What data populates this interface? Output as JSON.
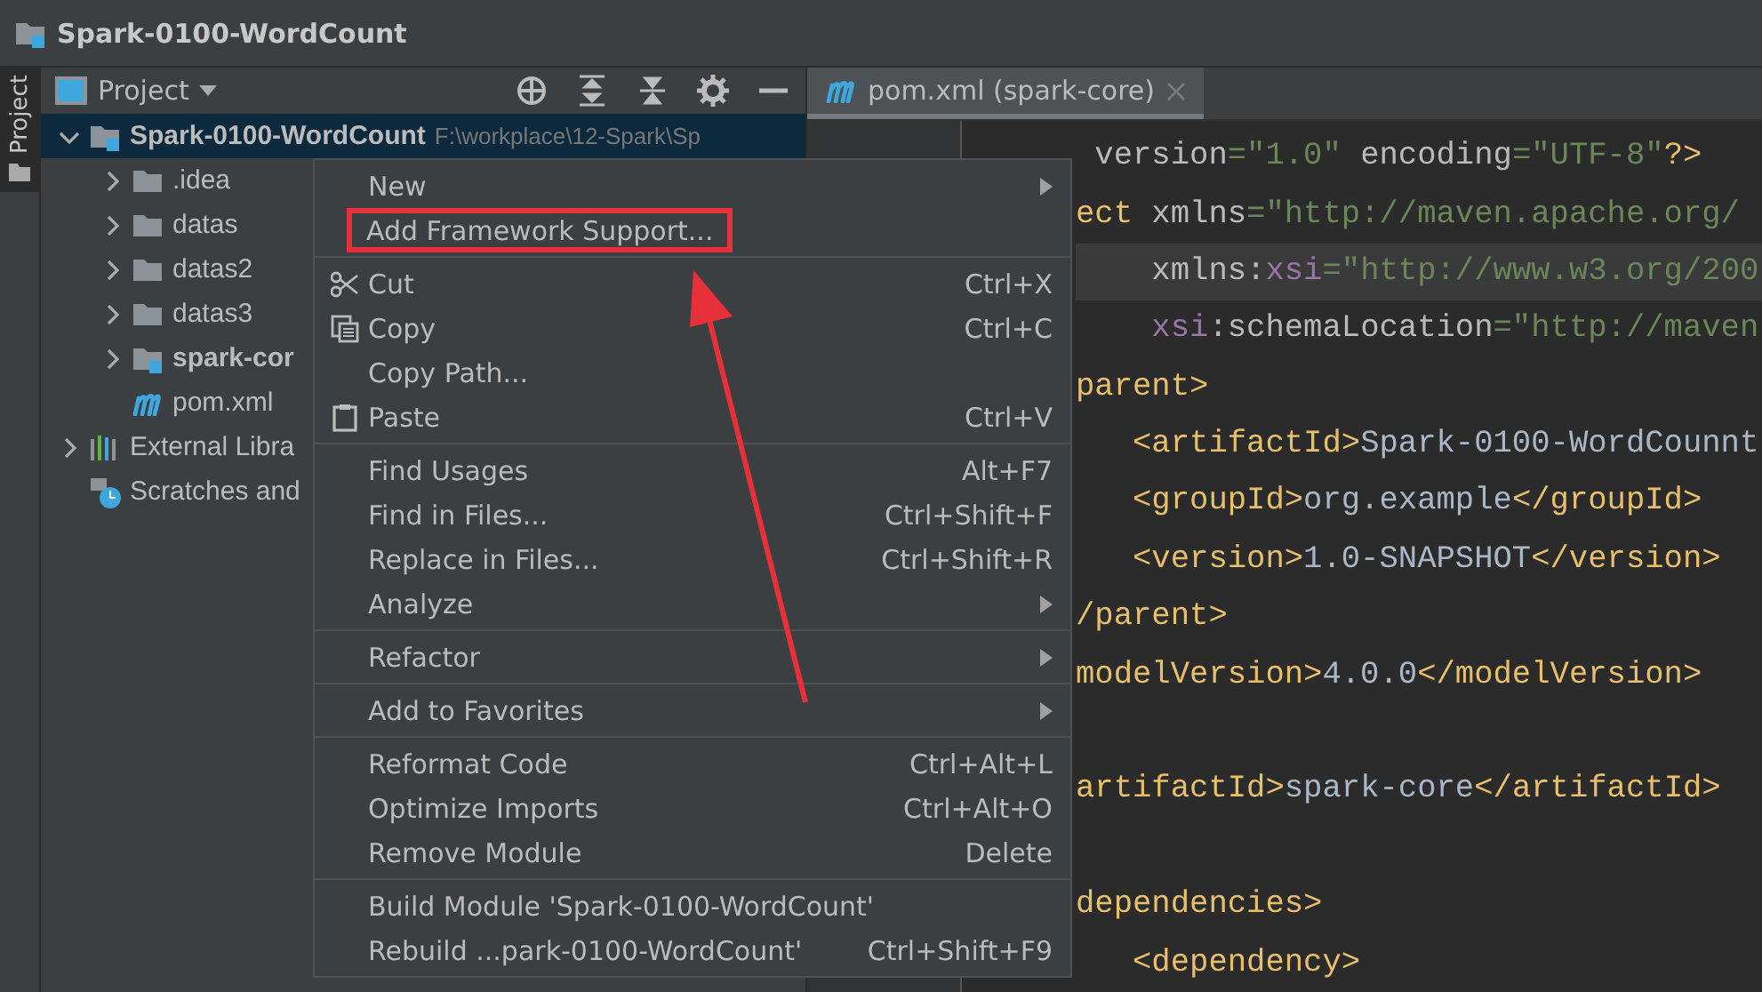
{
  "window": {
    "title": "Spark-0100-WordCount"
  },
  "side_strip": {
    "tab": "Project"
  },
  "project_panel": {
    "view": "Project",
    "tree": [
      {
        "label": "Spark-0100-WordCount",
        "path": "F:\\workplace\\12-Spark\\Sp",
        "kind": "module",
        "expanded": true,
        "selected": true,
        "children": [
          {
            "label": ".idea",
            "kind": "folder",
            "expanded": false,
            "selected": false
          },
          {
            "label": "datas",
            "kind": "folder",
            "expanded": false,
            "selected": false
          },
          {
            "label": "datas2",
            "kind": "folder",
            "expanded": false,
            "selected": false
          },
          {
            "label": "datas3",
            "kind": "folder",
            "expanded": false,
            "selected": false
          },
          {
            "label": "spark-cor",
            "kind": "module",
            "expanded": false,
            "selected": false
          },
          {
            "label": "pom.xml",
            "kind": "maven",
            "selected": false
          }
        ]
      },
      {
        "label": "External Libra",
        "kind": "library",
        "expanded": false,
        "selected": false
      },
      {
        "label": "Scratches and",
        "kind": "scratches",
        "selected": false
      }
    ]
  },
  "editor": {
    "tabs": [
      {
        "label": "pom.xml (spark-core)",
        "selected": true
      }
    ],
    "lines": [
      {
        "kind": "code",
        "current": false,
        "segments": [
          {
            "kind": "attr",
            "text": " version"
          },
          {
            "kind": "value",
            "text": "=\"1.0\""
          },
          {
            "kind": "attr",
            "text": " encoding"
          },
          {
            "kind": "value",
            "text": "=\"UTF-8\""
          },
          {
            "kind": "tag",
            "text": "?>"
          }
        ]
      },
      {
        "kind": "code",
        "current": false,
        "segments": [
          {
            "kind": "tag",
            "text": "ect"
          },
          {
            "kind": "attr",
            "text": " xmlns"
          },
          {
            "kind": "value",
            "text": "=\"http://maven.apache.org/"
          }
        ]
      },
      {
        "kind": "code",
        "current": true,
        "segments": [
          {
            "kind": "attr",
            "text": "    xmlns:"
          },
          {
            "kind": "ns",
            "text": "xsi"
          },
          {
            "kind": "value",
            "text": "=\"http://www.w3.org/200"
          }
        ]
      },
      {
        "kind": "code",
        "current": false,
        "segments": [
          {
            "kind": "ns",
            "text": "    xsi"
          },
          {
            "kind": "attr",
            "text": ":schemaLocation"
          },
          {
            "kind": "value",
            "text": "=\"http://maven"
          }
        ]
      },
      {
        "kind": "code",
        "current": false,
        "segments": [
          {
            "kind": "tag",
            "text": "parent>"
          }
        ]
      },
      {
        "kind": "code",
        "current": false,
        "segments": [
          {
            "kind": "tag",
            "text": "   <artifactId>"
          },
          {
            "kind": "text",
            "text": "Spark-0100-WordCounnt"
          }
        ]
      },
      {
        "kind": "code",
        "current": false,
        "segments": [
          {
            "kind": "tag",
            "text": "   <groupId>"
          },
          {
            "kind": "text",
            "text": "org.example"
          },
          {
            "kind": "tag",
            "text": "</groupId>"
          }
        ]
      },
      {
        "kind": "code",
        "current": false,
        "segments": [
          {
            "kind": "tag",
            "text": "   <version>"
          },
          {
            "kind": "text",
            "text": "1.0-SNAPSHOT"
          },
          {
            "kind": "tag",
            "text": "</version>"
          }
        ]
      },
      {
        "kind": "code",
        "current": false,
        "segments": [
          {
            "kind": "tag",
            "text": "/parent>"
          }
        ]
      },
      {
        "kind": "code",
        "current": false,
        "segments": [
          {
            "kind": "tag",
            "text": "modelVersion>"
          },
          {
            "kind": "text",
            "text": "4.0.0"
          },
          {
            "kind": "tag",
            "text": "</modelVersion>"
          }
        ]
      },
      {
        "kind": "blank"
      },
      {
        "kind": "code",
        "current": false,
        "segments": [
          {
            "kind": "tag",
            "text": "artifactId>"
          },
          {
            "kind": "text",
            "text": "spark-core"
          },
          {
            "kind": "tag",
            "text": "</artifactId>"
          }
        ]
      },
      {
        "kind": "blank"
      },
      {
        "kind": "code",
        "current": false,
        "segments": [
          {
            "kind": "tag",
            "text": "dependencies>"
          }
        ]
      },
      {
        "kind": "code",
        "current": false,
        "segments": [
          {
            "kind": "tag",
            "text": "   <dependency>"
          }
        ]
      }
    ]
  },
  "context_menu": {
    "items": [
      {
        "kind": "item",
        "label": "New",
        "submenu": true,
        "highlighted": false
      },
      {
        "kind": "item",
        "label": "Add Framework Support...",
        "submenu": false,
        "highlighted": true
      },
      {
        "kind": "separator"
      },
      {
        "kind": "item",
        "label": "Cut",
        "shortcut": "Ctrl+X",
        "submenu": false,
        "highlighted": false
      },
      {
        "kind": "item",
        "label": "Copy",
        "shortcut": "Ctrl+C",
        "submenu": false,
        "highlighted": false
      },
      {
        "kind": "item",
        "label": "Copy Path...",
        "submenu": false,
        "highlighted": false
      },
      {
        "kind": "item",
        "label": "Paste",
        "shortcut": "Ctrl+V",
        "submenu": false,
        "highlighted": false
      },
      {
        "kind": "separator"
      },
      {
        "kind": "item",
        "label": "Find Usages",
        "shortcut": "Alt+F7",
        "submenu": false,
        "highlighted": false
      },
      {
        "kind": "item",
        "label": "Find in Files...",
        "shortcut": "Ctrl+Shift+F",
        "submenu": false,
        "highlighted": false
      },
      {
        "kind": "item",
        "label": "Replace in Files...",
        "shortcut": "Ctrl+Shift+R",
        "submenu": false,
        "highlighted": false
      },
      {
        "kind": "item",
        "label": "Analyze",
        "submenu": true,
        "highlighted": false
      },
      {
        "kind": "separator"
      },
      {
        "kind": "item",
        "label": "Refactor",
        "submenu": true,
        "highlighted": false
      },
      {
        "kind": "separator"
      },
      {
        "kind": "item",
        "label": "Add to Favorites",
        "submenu": true,
        "highlighted": false
      },
      {
        "kind": "separator"
      },
      {
        "kind": "item",
        "label": "Reformat Code",
        "shortcut": "Ctrl+Alt+L",
        "submenu": false,
        "highlighted": false
      },
      {
        "kind": "item",
        "label": "Optimize Imports",
        "shortcut": "Ctrl+Alt+O",
        "submenu": false,
        "highlighted": false
      },
      {
        "kind": "item",
        "label": "Remove Module",
        "shortcut": "Delete",
        "submenu": false,
        "highlighted": false
      },
      {
        "kind": "separator"
      },
      {
        "kind": "item",
        "label": "Build Module 'Spark-0100-WordCount'",
        "submenu": false,
        "highlighted": false
      },
      {
        "kind": "item",
        "label": "Rebuild ...park-0100-WordCount'",
        "shortcut": "Ctrl+Shift+F9",
        "submenu": false,
        "highlighted": false
      }
    ]
  }
}
